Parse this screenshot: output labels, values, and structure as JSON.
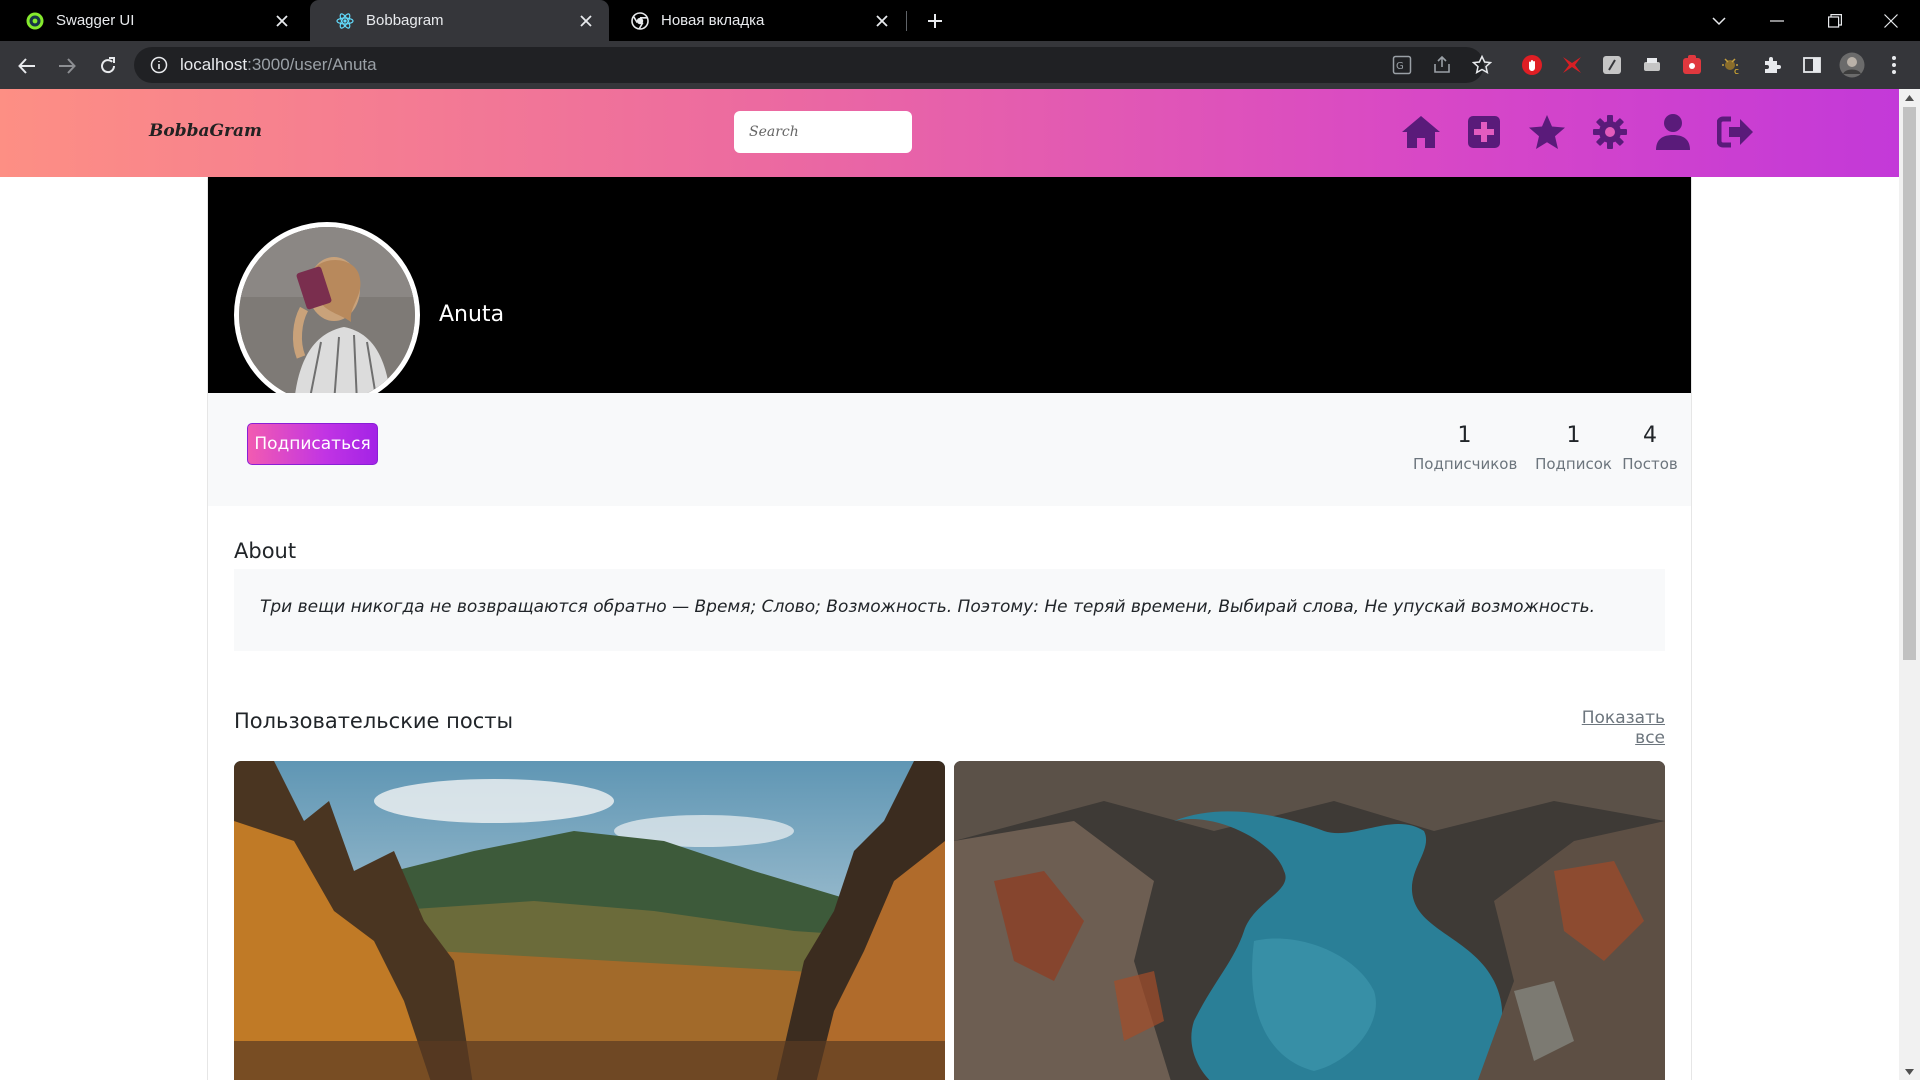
{
  "browser": {
    "tabs": [
      {
        "title": "Swagger UI",
        "active": false
      },
      {
        "title": "Bobbagram",
        "active": true
      },
      {
        "title": "Новая вкладка",
        "active": false
      }
    ],
    "url": {
      "host": "localhost",
      "path": ":3000/user/Anuta"
    }
  },
  "app": {
    "brand": "BobbaGram",
    "search_placeholder": "Search",
    "nav_icons": [
      "home-icon",
      "add-post-icon",
      "favorites-icon",
      "settings-icon",
      "profile-icon",
      "logout-icon"
    ],
    "gradient": [
      "#fd8f84",
      "#ec6aa0",
      "#d848c6",
      "#c339d8"
    ]
  },
  "profile": {
    "username": "Anuta",
    "subscribe_label": "Подписаться",
    "stats": [
      {
        "value": "1",
        "label": "Подписчиков"
      },
      {
        "value": "1",
        "label": "Подписок"
      },
      {
        "value": "4",
        "label": "Постов"
      }
    ]
  },
  "about": {
    "title": "About",
    "text": "Три вещи никогда не возвращаются обратно — Время; Слово; Возможность. Поэтому: Не теряй времени, Выбирай слова, Не упускай возможность."
  },
  "posts": {
    "title": "Пользовательские посты",
    "show_all": "Показать все",
    "items": [
      {
        "image": "autumn-mountain-forest"
      },
      {
        "image": "river-canyon-aerial"
      }
    ]
  }
}
